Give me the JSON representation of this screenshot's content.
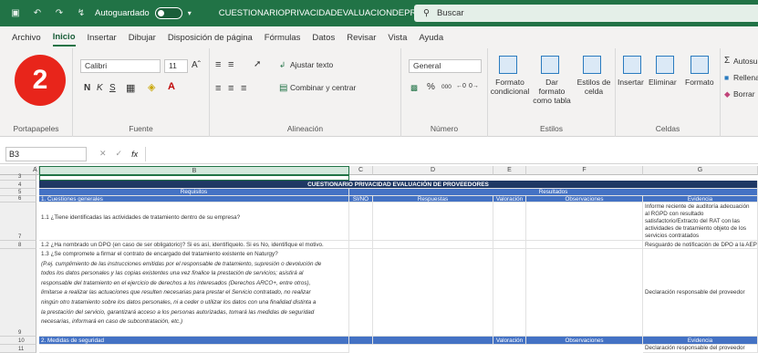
{
  "titlebar": {
    "autosave_label": "Autoguardado",
    "title": "CUESTIONARIOPRIVACIDADEVALUACIONDEPROVEEDORES - Excel",
    "search_placeholder": "Buscar"
  },
  "menu": [
    "Archivo",
    "Inicio",
    "Insertar",
    "Dibujar",
    "Disposición de página",
    "Fórmulas",
    "Datos",
    "Revisar",
    "Vista",
    "Ayuda"
  ],
  "ribbon": {
    "font_name": "Calibri",
    "font_size": "11",
    "bold": "N",
    "italic": "K",
    "underline": "S",
    "wrap_text": "Ajustar texto",
    "merge_center": "Combinar y centrar",
    "number_format": "General",
    "percent": "%",
    "thousands": "000",
    "conditional_format": "Formato condicional",
    "format_table": "Dar formato como tabla",
    "cell_styles": "Estilos de celda",
    "insert": "Insertar",
    "delete": "Eliminar",
    "format": "Formato",
    "autosum": "Autosuma",
    "fill": "Rellenar",
    "clear": "Borrar",
    "groups": {
      "clipboard": "Portapapeles",
      "font": "Fuente",
      "alignment": "Alineación",
      "number": "Número",
      "styles": "Estilos",
      "cells": "Celdas"
    }
  },
  "badge": "2",
  "formula": {
    "name_box": "B3",
    "fx": "fx"
  },
  "columns": [
    "A",
    "B",
    "C",
    "D",
    "E",
    "F",
    "G"
  ],
  "rows": [
    "3",
    "4",
    "5",
    "6",
    "7",
    "8",
    "9",
    "10",
    "11"
  ],
  "sheet": {
    "title": "CUESTIONARIO PRIVACIDAD EVALUACIÓN DE PROVEEDORES",
    "req_header": "Requisitos",
    "res_header": "Resultados",
    "cols": [
      "SI/NO",
      "Respuestas",
      "Valoración",
      "Observaciones",
      "Evidencia"
    ],
    "sec1": "1. Cuestiones generales",
    "q11": "1.1 ¿Tiene identificadas las actividades de tratamiento dentro de su empresa?",
    "ev11_lines": [
      "Informe reciente de auditoría adecuación",
      "al RGPD con resultado",
      "satisfactorio/Extracto del RAT con las",
      "actividades de tratamiento objeto de los",
      "servicios contratados"
    ],
    "q12": "1.2 ¿Ha nombrado un DPO (en caso de ser obligatorio)? Si es así, identifíquelo. Si es No, identifique el motivo.",
    "ev12": "Resguardo de notificación de DPO a la AEPD",
    "q13_title": "1.3 ¿Se compromete a firmar el contrato de encargado del tratamiento existente en Naturgy?",
    "q13_lines": [
      "(P.ej. cumplimiento de las instrucciones emitidas por el responsable de tratamiento, supresión o devolución de",
      "todos los datos personales y las copias existentes una vez finalice la prestación de servicios; asistirá al",
      "responsable del tratamiento en el ejercicio de derechos a los interesados (Derechos ARCO+, entre otros),",
      "limitarse a realizar las actuaciones que resulten necesarias para prestar el Servicio contratado, no realizar",
      "ningún otro tratamiento sobre los datos personales, ni a ceder o utilizar los datos con una finalidad distinta a",
      "la prestación del servicio, garantizará acceso a los personas autorizadas, tomará las medidas de seguridad",
      "necesarias, informará en caso de subcontratación, etc.)"
    ],
    "ev13": "Declaración responsable del proveedor",
    "sec2": "2. Medidas de seguridad",
    "ev_next": "Declaración responsable del proveedor"
  }
}
